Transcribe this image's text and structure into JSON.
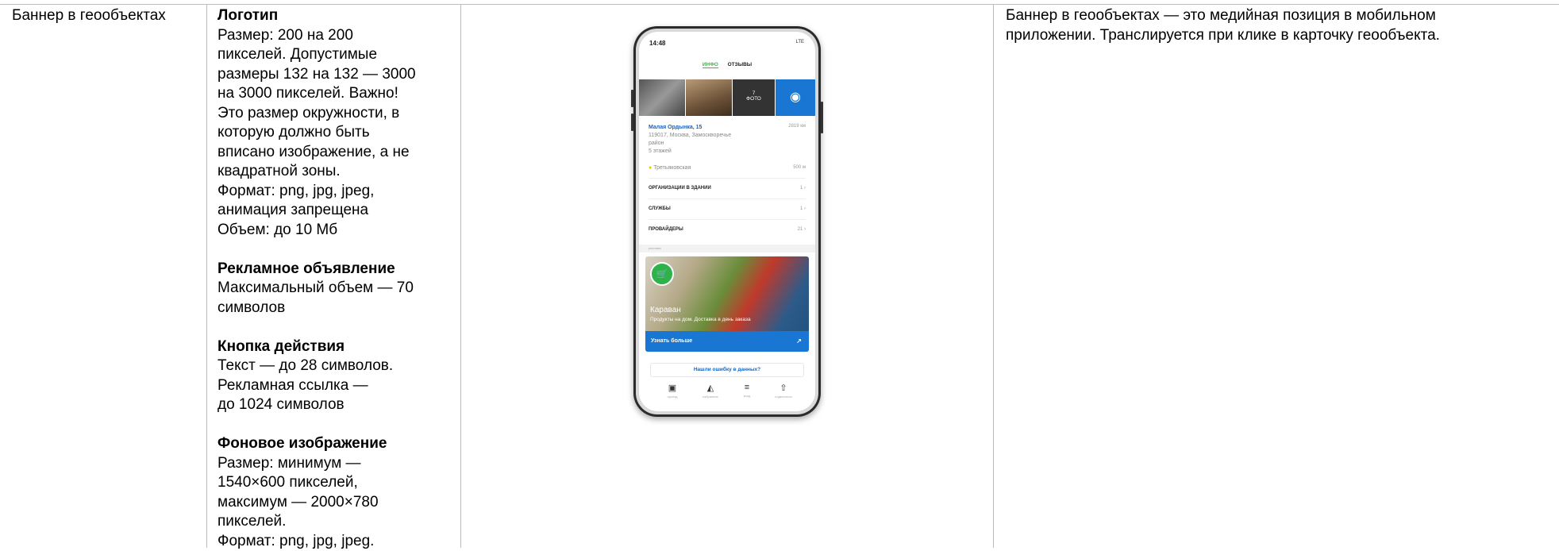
{
  "row": {
    "name": "Баннер в геообъектах",
    "requirements": {
      "logo": {
        "title": "Логотип",
        "lines": [
          "Размер: 200 на 200",
          "пикселей. Допустимые",
          "размеры 132 на 132 — 3000",
          "на 3000 пикселей. Важно!",
          "Это размер окружности, в",
          "которую должно быть",
          "вписано изображение, а не",
          "квадратной зоны.",
          "Формат: png, jpg, jpeg,",
          "анимация запрещена",
          "Объем: до 10 Мб"
        ]
      },
      "ad_text": {
        "title": "Рекламное объявление",
        "lines": [
          "Максимальный объем — 70",
          "символов"
        ]
      },
      "action_button": {
        "title": "Кнопка действия",
        "lines": [
          "Текст — до 28 символов.",
          "Рекламная ссылка —",
          "до 1024 символов"
        ]
      },
      "background": {
        "title": "Фоновое изображение",
        "lines": [
          "Размер: минимум —",
          "1540×600 пикселей,",
          "максимум — 2000×780",
          "пикселей.",
          "Формат: png, jpg, jpeg."
        ]
      }
    },
    "description_lines": [
      "Баннер в геообъектах — это медийная позиция в мобильном",
      "приложении. Транслируется при клике в карточку геообъекта."
    ]
  },
  "phone": {
    "time": "14:48",
    "status_right": "LTE",
    "tabs": [
      "ИНФО",
      "ОТЗЫВЫ"
    ],
    "photo_count": "7",
    "photo_label": "ФОТО",
    "address_title": "Малая Ордынка, 15",
    "distance": "2819 км",
    "address_lines": [
      "119017, Москва, Замоскворечье",
      "район",
      "5 этажей"
    ],
    "metro": "Третьяковская",
    "metro_distance": "500 м",
    "rows": [
      {
        "label": "ОРГАНИЗАЦИИ В ЗДАНИИ",
        "count": "1"
      },
      {
        "label": "СЛУЖБЫ",
        "count": "1"
      },
      {
        "label": "ПРОВАЙДЕРЫ",
        "count": "21"
      }
    ],
    "ad_mark": "реклама",
    "banner_title": "Караван",
    "banner_subtitle": "Продукты на дом. Доставка в день заказа",
    "banner_cta": "Узнать больше",
    "error_link": "Нашли ошибку в данных?",
    "nav": [
      "проезд",
      "избранное",
      "вход",
      "поделиться"
    ]
  }
}
